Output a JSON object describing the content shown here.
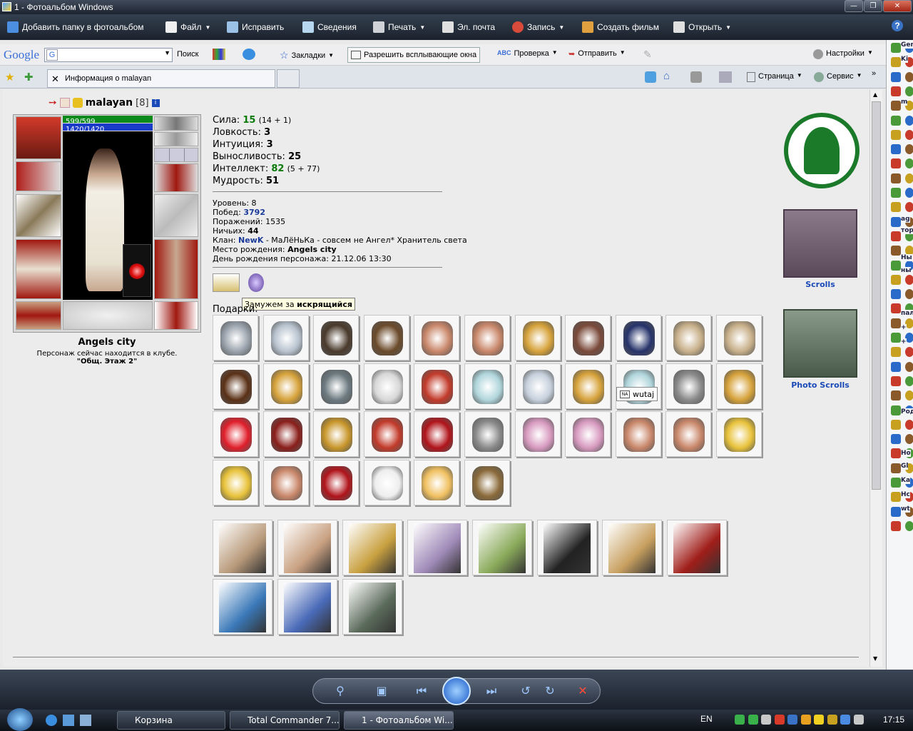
{
  "window": {
    "title": "1 - Фотоальбом Windows",
    "min": "—",
    "max": "❐",
    "close": "✕"
  },
  "gallery_toolbar": {
    "add_folder": "Добавить папку в фотоальбом",
    "file": "Файл",
    "fix": "Исправить",
    "info": "Сведения",
    "print": "Печать",
    "email": "Эл. почта",
    "burn": "Запись",
    "movie": "Создать фильм",
    "open": "Открыть",
    "help": "?"
  },
  "google_bar": {
    "logo": "Google",
    "search": "Поиск",
    "bookmarks": "Закладки",
    "popups": "Разрешить всплывающие окна",
    "spellcheck": "Проверка",
    "send": "Отправить",
    "settings": "Настройки"
  },
  "ie": {
    "tab_title": "Информация о malayan",
    "page_menu": "Страница",
    "tools_menu": "Сервис"
  },
  "character": {
    "name": "malayan",
    "level_tag": "[8]",
    "hp": "599/599",
    "mana": "1420/1420",
    "city": "Angels city",
    "location_line": "Персонаж сейчас находится в клубе.",
    "location_room": "\"Общ. Этаж 2\""
  },
  "stats": {
    "strength_label": "Сила:",
    "strength": "15",
    "strength_extra": "(14 + 1)",
    "agility_label": "Ловкость:",
    "agility": "3",
    "intuition_label": "Интуиция:",
    "intuition": "3",
    "endurance_label": "Выносливость:",
    "endurance": "25",
    "intellect_label": "Интеллект:",
    "intellect": "82",
    "intellect_extra": "(5 + 77)",
    "wisdom_label": "Мудрость:",
    "wisdom": "51"
  },
  "info": {
    "level_label": "Уровень:",
    "level": "8",
    "wins_label": "Побед:",
    "wins": "3792",
    "losses_label": "Поражений:",
    "losses": "1535",
    "draws_label": "Ничьих:",
    "draws": "44",
    "clan_label": "Клан:",
    "clan": "NewK",
    "clan_desc": "- МаЛёНьКа - совсем не Ангел* Хранитель света",
    "birthplace_label": "Место рождения:",
    "birthplace": "Angels city",
    "birthday_label": "День рождения персонажа:",
    "birthday": "21.12.06 13:30"
  },
  "married_tooltip": {
    "prefix": "Замужем за",
    "name": "искрящийся"
  },
  "gifts_label": "Подарки:",
  "gift_tooltip": "wutaj",
  "gifts": [
    {
      "color": "#9aa3ad"
    },
    {
      "color": "#b8c3cf"
    },
    {
      "color": "#4a3a2c"
    },
    {
      "color": "#6b4a2a"
    },
    {
      "color": "#c9876a"
    },
    {
      "color": "#c9876a"
    },
    {
      "color": "#d6a23a"
    },
    {
      "color": "#7a4a3a"
    },
    {
      "color": "#26336a"
    },
    {
      "color": "#c8b08a"
    },
    {
      "color": "#c8b08a"
    },
    {
      "color": "#5a3016"
    },
    {
      "color": "#d6a23a"
    },
    {
      "color": "#6c7a80"
    },
    {
      "color": "#d8d8d8"
    },
    {
      "color": "#c23a2a"
    },
    {
      "color": "#b0d6dc"
    },
    {
      "color": "#c6d0dc"
    },
    {
      "color": "#d6a23a"
    },
    {
      "color": "#b0d6dc"
    },
    {
      "color": "#8a8a8a"
    },
    {
      "color": "#d6a23a"
    },
    {
      "color": "#e01e2a"
    },
    {
      "color": "#8a1e1a"
    },
    {
      "color": "#c8962a"
    },
    {
      "color": "#c23a2a"
    },
    {
      "color": "#b0141a"
    },
    {
      "color": "#8a8a8a"
    },
    {
      "color": "#d89ac0"
    },
    {
      "color": "#d89ac0"
    },
    {
      "color": "#c9876a"
    },
    {
      "color": "#c9876a"
    },
    {
      "color": "#e8c23a"
    },
    {
      "color": "#e8c23a"
    },
    {
      "color": "#c9876a"
    },
    {
      "color": "#b0141a"
    },
    {
      "color": "#eeeeee"
    },
    {
      "color": "#f0c060"
    },
    {
      "color": "#8a6a3a"
    }
  ],
  "cards": [
    {
      "color": "#b89a7a"
    },
    {
      "color": "#c8a080"
    },
    {
      "color": "#c8a040"
    },
    {
      "color": "#a08ab8"
    },
    {
      "color": "#8aaa5a"
    },
    {
      "color": "#222222"
    },
    {
      "color": "#c8a060"
    },
    {
      "color": "#a01e1a"
    },
    {
      "color": "#3a78b8"
    },
    {
      "color": "#4a6ab8"
    },
    {
      "color": "#5a6a5a"
    }
  ],
  "badges": {
    "scrolls": "Scrolls",
    "photo_scrolls": "Photo Scrolls"
  },
  "taskbar": {
    "lang": "EN",
    "time": "17:15",
    "tasks": [
      "Корзина",
      "Total Commander 7...",
      "1 - Фотоальбом Wi..."
    ]
  },
  "sidebar_labels": [
    "Ger",
    "Ki",
    "m",
    "ag",
    "тор",
    "Ны",
    "ны",
    "пал",
    "+",
    "+",
    "Род",
    "Ho",
    "Gl",
    "Ka",
    "Hc",
    "wt"
  ]
}
